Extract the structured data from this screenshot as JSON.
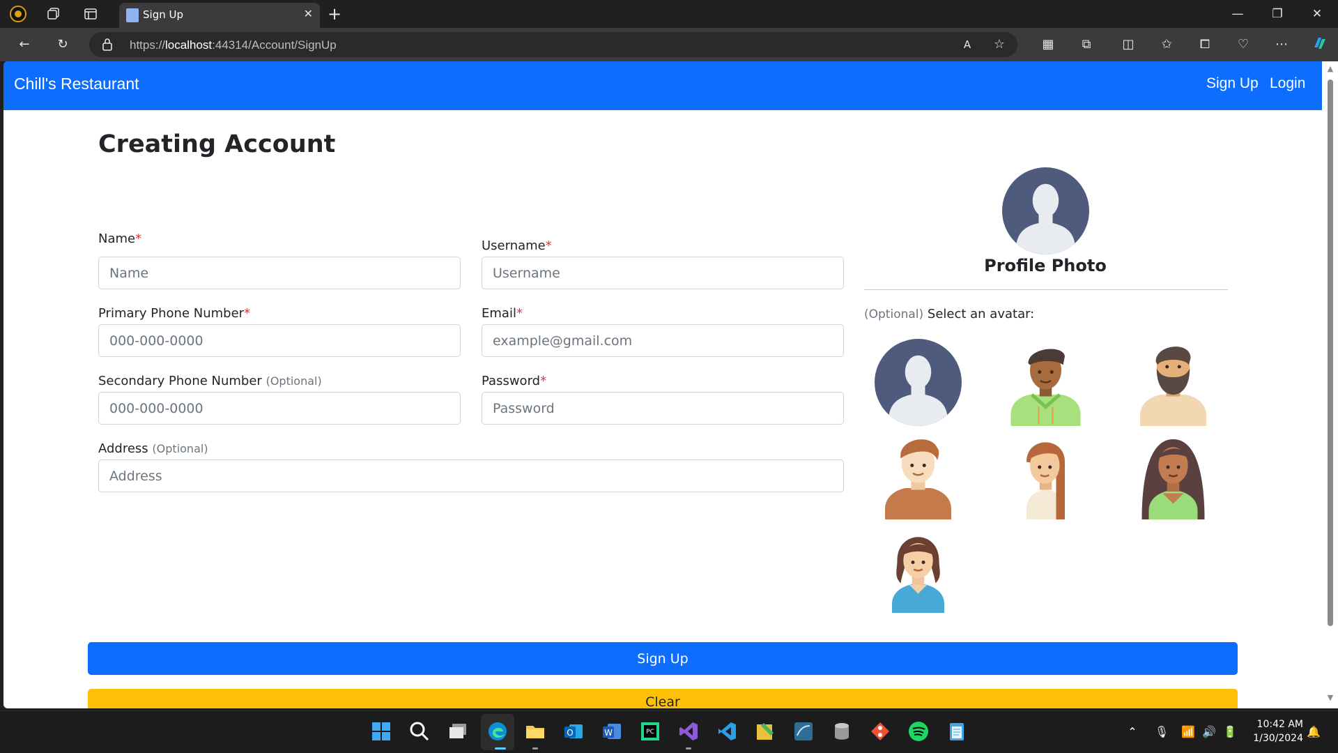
{
  "browser": {
    "tab_title": "Sign Up",
    "url_prefix": "https://",
    "url_host": "localhost",
    "url_rest": ":44314/Account/SignUp"
  },
  "navbar": {
    "brand": "Chill's Restaurant",
    "links": [
      "Sign Up",
      "Login"
    ]
  },
  "form": {
    "title": "Creating Account",
    "required_mark": "*",
    "optional_text": "(Optional)",
    "fields": {
      "name": {
        "label": "Name",
        "placeholder": "Name"
      },
      "username": {
        "label": "Username",
        "placeholder": "Username"
      },
      "primary_phone": {
        "label": "Primary Phone Number",
        "placeholder": "000-000-0000"
      },
      "email": {
        "label": "Email",
        "placeholder": "example@gmail.com"
      },
      "secondary_phone": {
        "label": "Secondary Phone Number",
        "placeholder": "000-000-0000"
      },
      "password": {
        "label": "Password",
        "placeholder": "Password"
      },
      "address": {
        "label": "Address",
        "placeholder": "Address"
      }
    },
    "profile_photo_label": "Profile Photo",
    "avatar_heading": "Select an avatar:",
    "avatars": [
      "default-silhouette-avatar",
      "man-green-hoodie-avatar",
      "bearded-man-avatar",
      "redhead-boy-avatar",
      "woman-long-hair-avatar",
      "curly-hair-woman-avatar",
      "girl-blue-top-avatar"
    ],
    "signup_button": "Sign Up",
    "clear_button": "Clear"
  },
  "taskbar": {
    "time": "10:42 AM",
    "date": "1/30/2024"
  },
  "colors": {
    "primary": "#0d6efd",
    "warning": "#ffc107",
    "danger": "#dc3545",
    "avatar_default_bg": "#4f5b7d"
  }
}
